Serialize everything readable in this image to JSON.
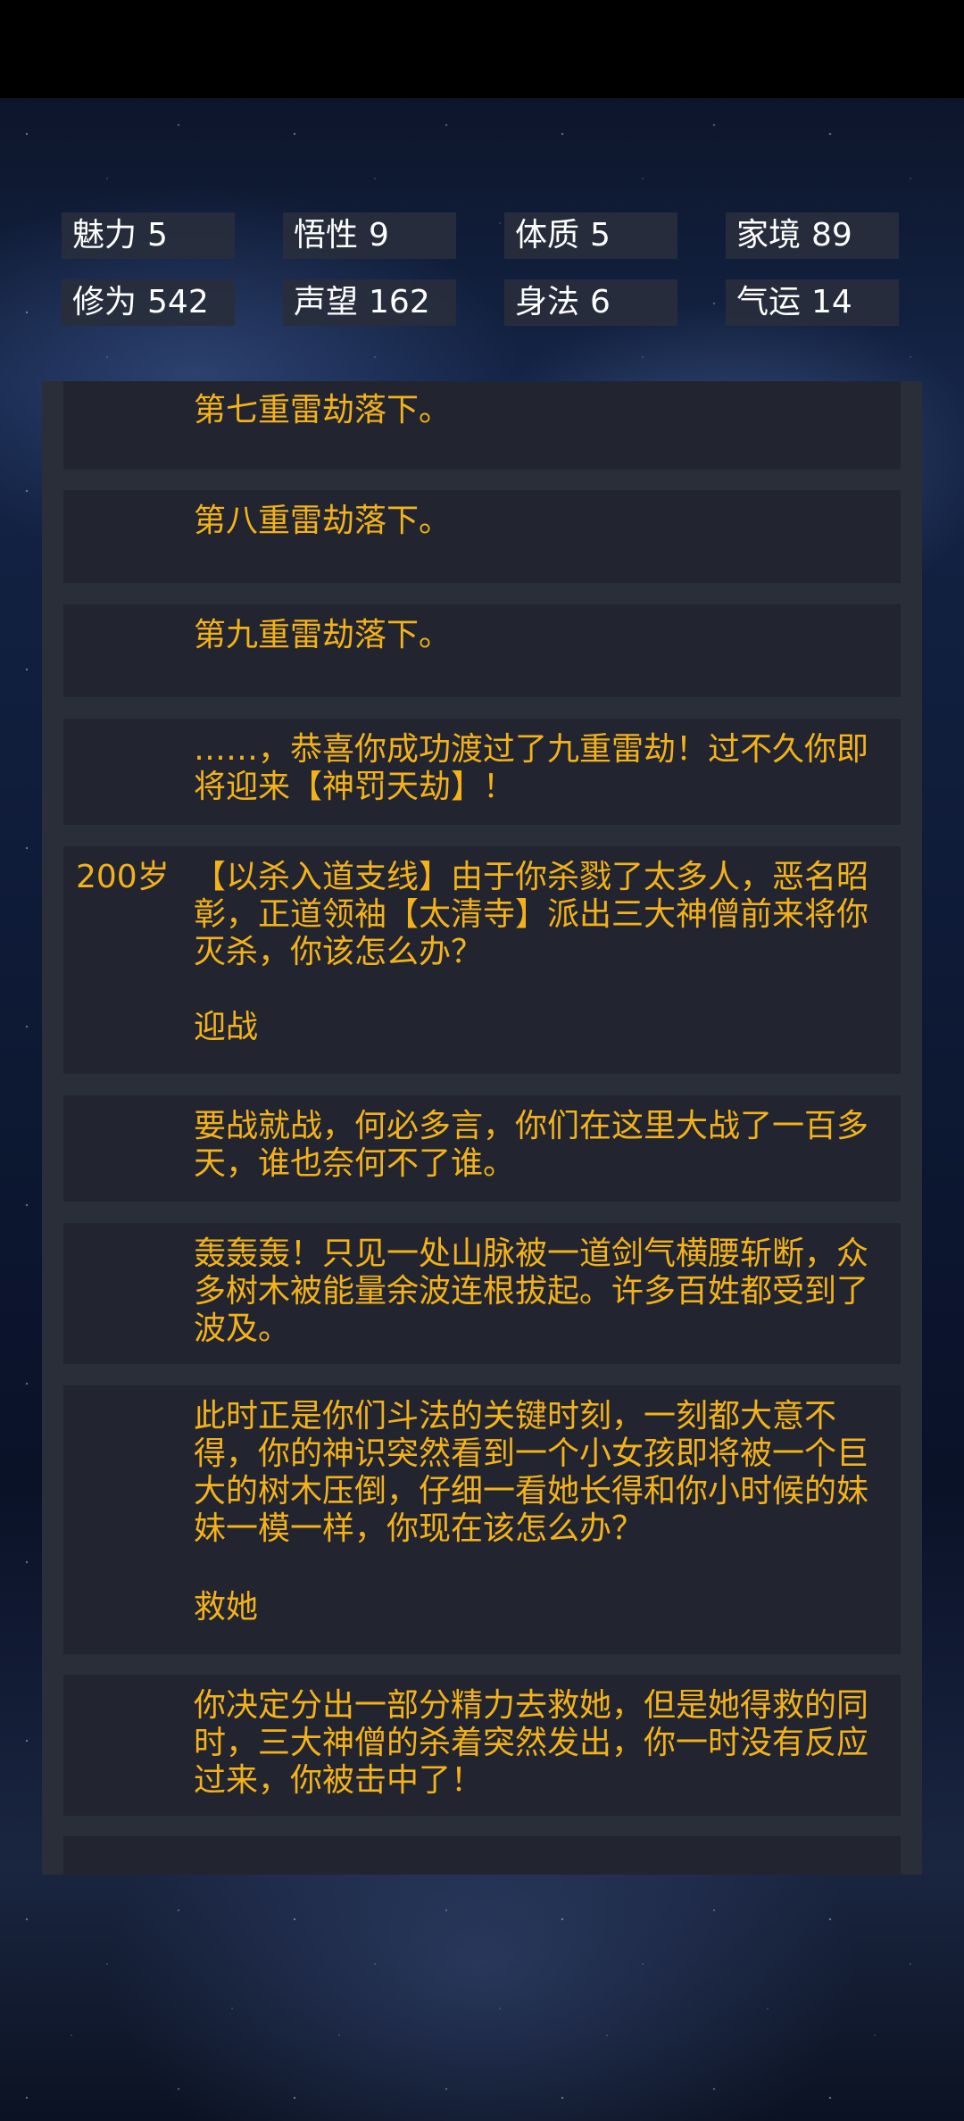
{
  "stats": [
    {
      "label": "魅力",
      "value": "5"
    },
    {
      "label": "悟性",
      "value": "9"
    },
    {
      "label": "体质",
      "value": "5"
    },
    {
      "label": "家境",
      "value": "89"
    },
    {
      "label": "修为",
      "value": "542"
    },
    {
      "label": "声望",
      "value": "162"
    },
    {
      "label": "身法",
      "value": "6"
    },
    {
      "label": "气运",
      "value": "14"
    }
  ],
  "entries": [
    {
      "age": "",
      "text": "第七重雷劫落下。",
      "choice": ""
    },
    {
      "age": "",
      "text": "第八重雷劫落下。",
      "choice": ""
    },
    {
      "age": "",
      "text": "第九重雷劫落下。",
      "choice": ""
    },
    {
      "age": "",
      "text": "……，恭喜你成功渡过了九重雷劫！过不久你即将迎来【神罚天劫】！",
      "choice": ""
    },
    {
      "age": "200岁",
      "text": "【以杀入道支线】由于你杀戮了太多人，恶名昭彰，正道领袖【太清寺】派出三大神僧前来将你灭杀，你该怎么办？",
      "choice": "迎战"
    },
    {
      "age": "",
      "text": "要战就战，何必多言，你们在这里大战了一百多天，谁也奈何不了谁。",
      "choice": ""
    },
    {
      "age": "",
      "text": "轰轰轰！只见一处山脉被一道剑气横腰斩断，众多树木被能量余波连根拔起。许多百姓都受到了波及。",
      "choice": ""
    },
    {
      "age": "",
      "text": "此时正是你们斗法的关键时刻，一刻都大意不得，你的神识突然看到一个小女孩即将被一个巨大的树木压倒，仔细一看她长得和你小时候的妹妹一模一样，你现在该怎么办？",
      "choice": "救她"
    },
    {
      "age": "",
      "text": "你决定分出一部分精力去救她，但是她得救的同时，三大神僧的杀着突然发出，你一时没有反应过来，你被击中了！",
      "choice": ""
    }
  ]
}
